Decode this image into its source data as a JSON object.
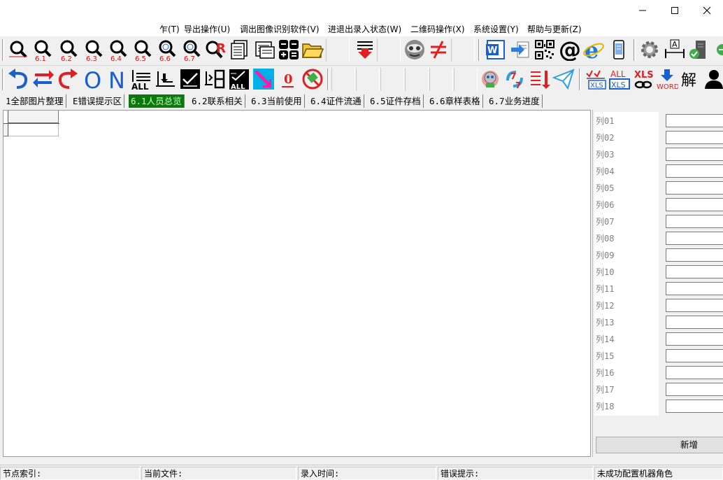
{
  "window": {
    "minimize_icon": "minimize-icon",
    "maximize_icon": "maximize-icon",
    "close_icon": "close-icon"
  },
  "menu": [
    {
      "label": "乍(T)"
    },
    {
      "label": "导出操作(U)"
    },
    {
      "label": "调出图像识别软件(V)"
    },
    {
      "label": "进退出录入状态(W)"
    },
    {
      "label": "二维码操作(X)"
    },
    {
      "label": "系统设置(Y)"
    },
    {
      "label": "帮助与更新(Z)"
    }
  ],
  "toolbar1": {
    "zoom_labels": [
      "6.1",
      "6.2",
      "6.3",
      "6.4",
      "6.5",
      "6.6",
      "6.7"
    ],
    "colors": {
      "zoom_label": "#d01010",
      "accent_blue": "#1a5fd0",
      "accent_red": "#e02020"
    }
  },
  "toolbar2": {
    "zero_label": "0",
    "o_label": "O",
    "n_label": "N",
    "all_label": "ALL",
    "xls_label": "XLS",
    "word_label": "WORD",
    "jie_label": "解"
  },
  "tabs": [
    {
      "label": "1全部图片整理",
      "active": false
    },
    {
      "label": "E错误提示区",
      "active": false
    },
    {
      "label": "6.1人员总览",
      "active": true
    },
    {
      "label": "6.2联系相关",
      "active": false
    },
    {
      "label": "6.3当前使用",
      "active": false
    },
    {
      "label": "6.4证件流通",
      "active": false
    },
    {
      "label": "6.5证件存档",
      "active": false
    },
    {
      "label": "6.6章样表格",
      "active": false
    },
    {
      "label": "6.7业务进度",
      "active": false
    }
  ],
  "columns": [
    "列01",
    "列02",
    "列03",
    "列04",
    "列05",
    "列06",
    "列07",
    "列08",
    "列09",
    "列10",
    "列11",
    "列12",
    "列13",
    "列14",
    "列15",
    "列16",
    "列17",
    "列18"
  ],
  "add_button": "新增",
  "status": {
    "node_index": "节点索引:",
    "current_file": "当前文件:",
    "entry_time": "录入时间:",
    "error_hint": "错误提示:",
    "robot_role": "未成功配置机器角色"
  }
}
